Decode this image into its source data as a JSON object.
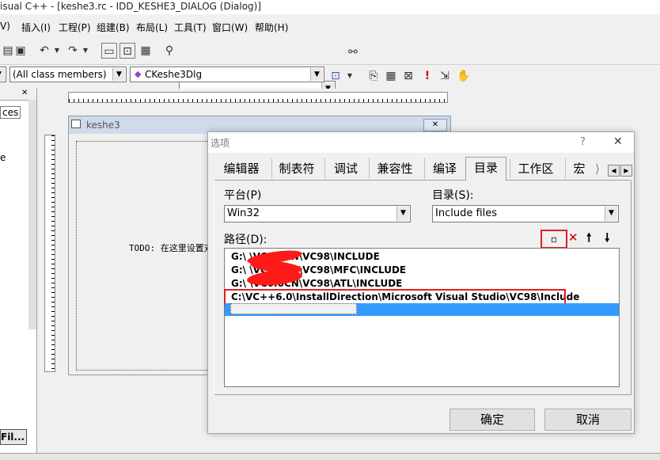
{
  "window": {
    "title": "isual C++ - [keshe3.rc - IDD_KESHE3_DIALOG (Dialog)]"
  },
  "menu": [
    "V)",
    "插入(I)",
    "工程(P)",
    "组建(B)",
    "布局(L)",
    "工具(T)",
    "窗口(W)",
    "帮助(H)"
  ],
  "toolbar": {
    "find_combo_value": "",
    "class_filter": "(All class members)",
    "class_name": "CKeshe3Dlg"
  },
  "left_panel": {
    "tab_label": "ces",
    "files_button": "Fil..."
  },
  "editor_dialog": {
    "title": "keshe3",
    "todo_text": "TODO: 在这里设置对"
  },
  "options": {
    "title": "选项",
    "help": "?",
    "close": "✕",
    "tabs": [
      "编辑器",
      "制表符",
      "调试",
      "兼容性",
      "编译",
      "目录",
      "工作区",
      "宏"
    ],
    "platform_label": "平台(P)",
    "platform_value": "Win32",
    "dir_label": "目录(S):",
    "dir_value": "Include files",
    "path_label": "路径(D):",
    "paths": [
      "G:\\                \\VC6.0CN\\VC98\\INCLUDE",
      "G:\\                \\VC6.0CN\\VC98\\MFC\\INCLUDE",
      "G:\\                \\VC6.0CN\\VC98\\ATL\\INCLUDE",
      "C:\\VC++6.0\\InstallDirection\\Microsoft Visual Studio\\VC98\\Include"
    ],
    "ok_button": "确定",
    "cancel_button": "取消"
  },
  "colors": {
    "highlight_red": "#e02020",
    "selection_blue": "#3399ff"
  }
}
